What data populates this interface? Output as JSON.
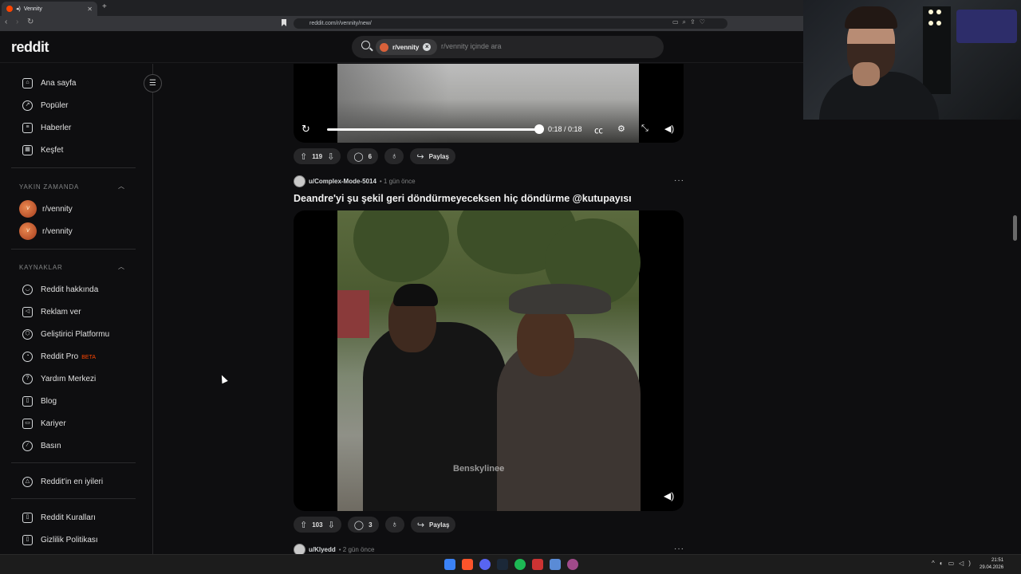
{
  "browser": {
    "tab_title": "Vennity",
    "url": "reddit.com/r/vennity/new/"
  },
  "header": {
    "logo": "reddit",
    "search": {
      "chip_label": "r/vennity",
      "placeholder": "r/vennity içinde ara"
    }
  },
  "sidebar": {
    "main_items": [
      {
        "label": "Ana sayfa",
        "icon": "home-icon"
      },
      {
        "label": "Popüler",
        "icon": "popular-icon"
      },
      {
        "label": "Haberler",
        "icon": "news-icon"
      },
      {
        "label": "Keşfet",
        "icon": "explore-icon"
      }
    ],
    "recent_header": "YAKIN ZAMANDA",
    "recent": [
      {
        "label": "r/vennity"
      },
      {
        "label": "r/vennity"
      }
    ],
    "resources_header": "KAYNAKLAR",
    "resources": [
      {
        "label": "Reddit hakkında",
        "icon": "reddit-alien-icon"
      },
      {
        "label": "Reklam ver",
        "icon": "megaphone-icon"
      },
      {
        "label": "Geliştirici Platformu",
        "icon": "developer-platform-icon"
      },
      {
        "label": "Reddit Pro",
        "icon": "pro-icon",
        "badge": "BETA"
      },
      {
        "label": "Yardım Merkezi",
        "icon": "help-icon"
      },
      {
        "label": "Blog",
        "icon": "book-icon"
      },
      {
        "label": "Kariyer",
        "icon": "briefcase-icon"
      },
      {
        "label": "Basın",
        "icon": "pen-icon"
      }
    ],
    "best_of": {
      "label": "Reddit'in en iyileri",
      "icon": "best-of-icon"
    },
    "policy": [
      {
        "label": "Reddit Kuralları",
        "icon": "rules-book-icon"
      },
      {
        "label": "Gizlilik Politikası",
        "icon": "privacy-book-icon"
      }
    ]
  },
  "feed": {
    "post1": {
      "video_time": "0:18 / 0:18",
      "progress": 1.0,
      "votes": "119",
      "comments": "6",
      "share_label": "Paylaş"
    },
    "post2": {
      "username": "u/Complex-Mode-5014",
      "time": "• 1 gün önce",
      "title": "Deandre'yi şu şekil geri döndürmeyeceksen hiç döndürme @kutupayısı",
      "watermark": "Benskylinee",
      "votes": "103",
      "comments": "3",
      "share_label": "Paylaş"
    },
    "post3": {
      "username": "u/Klyedd",
      "time": "• 2 gün önce"
    }
  },
  "taskbar": {
    "clock_time": "21:51",
    "clock_date": "29.04.2026"
  }
}
